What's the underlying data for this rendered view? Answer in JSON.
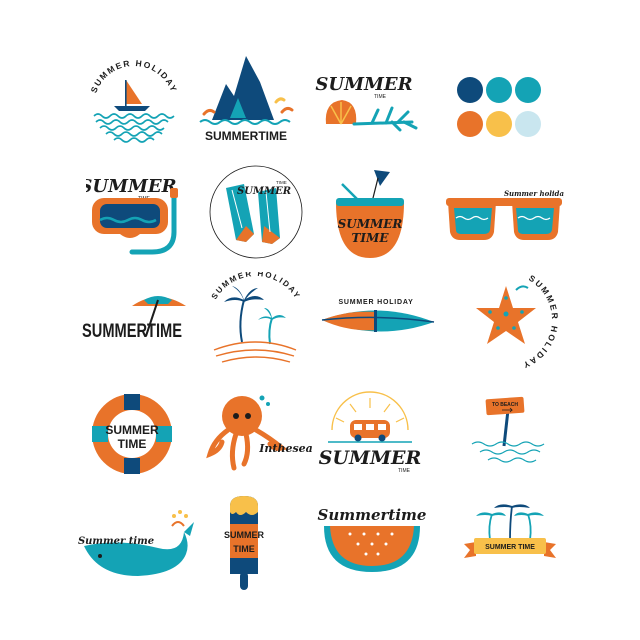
{
  "colors": {
    "navy": "#0e4a7b",
    "teal": "#14a3b5",
    "orange": "#e8732a",
    "yellow": "#f8c04a",
    "light_blue": "#c9e6ef",
    "ink": "#1c1c1c"
  },
  "palette": [
    "#0e4a7b",
    "#14a3b5",
    "#e8732a",
    "#f8c04a",
    "#c9e6ef"
  ],
  "badges": [
    {
      "name": "sailboat-badge",
      "text": "SUMMER HOLIDAY",
      "icon": "sailboat-icon"
    },
    {
      "name": "mountain-badge",
      "text": "SUMMERTIME",
      "icon": "mountain-icon"
    },
    {
      "name": "seashell-badge",
      "text": "SUMMER",
      "small": "TIME",
      "icon": "seashell-icon"
    },
    {
      "name": "palette-swatches",
      "icon": "color-swatch-icon"
    },
    {
      "name": "snorkel-badge",
      "text": "SUMMER",
      "small": "TIME",
      "icon": "diving-mask-icon"
    },
    {
      "name": "flippers-badge",
      "text": "SUMMER",
      "small": "TIME",
      "icon": "flippers-icon"
    },
    {
      "name": "coconut-badge",
      "text": "SUMMER",
      "small": "TIME",
      "icon": "coconut-drink-icon"
    },
    {
      "name": "sunglasses-badge",
      "text": "Summer holiday",
      "icon": "sunglasses-icon"
    },
    {
      "name": "umbrella-badge",
      "text": "SUMMERTIME",
      "icon": "beach-umbrella-icon"
    },
    {
      "name": "palm-island-badge",
      "text": "SUMMER HOLIDAY",
      "icon": "palm-tree-icon"
    },
    {
      "name": "surfboard-badge",
      "text": "SUMMER HOLIDAY",
      "icon": "surfboard-icon"
    },
    {
      "name": "starfish-badge",
      "text": "SUMMER HOLIDAY",
      "icon": "starfish-icon"
    },
    {
      "name": "lifebuoy-badge",
      "text": "SUMMER",
      "small": "TIME",
      "icon": "lifebuoy-icon"
    },
    {
      "name": "octopus-badge",
      "text": "Inthesea",
      "icon": "octopus-icon"
    },
    {
      "name": "van-badge",
      "text": "SUMMER",
      "small": "TIME",
      "icon": "camper-van-icon"
    },
    {
      "name": "beach-sign-badge",
      "text": "TO BEACH",
      "icon": "signpost-icon"
    },
    {
      "name": "whale-badge",
      "text": "Summer time",
      "icon": "whale-icon"
    },
    {
      "name": "popsicle-badge",
      "text": "SUMMER",
      "small": "TIME",
      "icon": "popsicle-icon"
    },
    {
      "name": "watermelon-badge",
      "text": "Summertime",
      "icon": "watermelon-icon"
    },
    {
      "name": "palm-ribbon-badge",
      "text": "SUMMER TIME",
      "icon": "palm-tree-icon"
    }
  ]
}
